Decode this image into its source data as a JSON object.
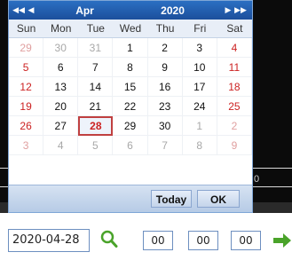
{
  "background": {
    "side_label": "0"
  },
  "calendar": {
    "nav": {
      "prev_year": "◀◀",
      "prev_month": "◀",
      "next_month": "▶",
      "next_year": "▶▶"
    },
    "month": "Apr",
    "year": "2020",
    "weekdays": [
      "Sun",
      "Mon",
      "Tue",
      "Wed",
      "Thu",
      "Fri",
      "Sat"
    ],
    "weeks": [
      [
        "29",
        "30",
        "31",
        "1",
        "2",
        "3",
        "4"
      ],
      [
        "5",
        "6",
        "7",
        "8",
        "9",
        "10",
        "11"
      ],
      [
        "12",
        "13",
        "14",
        "15",
        "16",
        "17",
        "18"
      ],
      [
        "19",
        "20",
        "21",
        "22",
        "23",
        "24",
        "25"
      ],
      [
        "26",
        "27",
        "28",
        "29",
        "30",
        "1",
        "2"
      ],
      [
        "3",
        "4",
        "5",
        "6",
        "7",
        "8",
        "9"
      ]
    ],
    "selected_day": "28",
    "today_label": "Today",
    "ok_label": "OK",
    "colors": {
      "header": "#2b6fc2",
      "weekend": "#cc2222",
      "selected_border": "#c04040",
      "other_month": "#a8a8a8"
    }
  },
  "controls": {
    "date_value": "2020-04-28",
    "hour": "00",
    "minute": "00",
    "second": "00",
    "search_icon": "search-icon",
    "go_icon": "arrow-right-icon",
    "icon_color": "#4aa32a"
  }
}
